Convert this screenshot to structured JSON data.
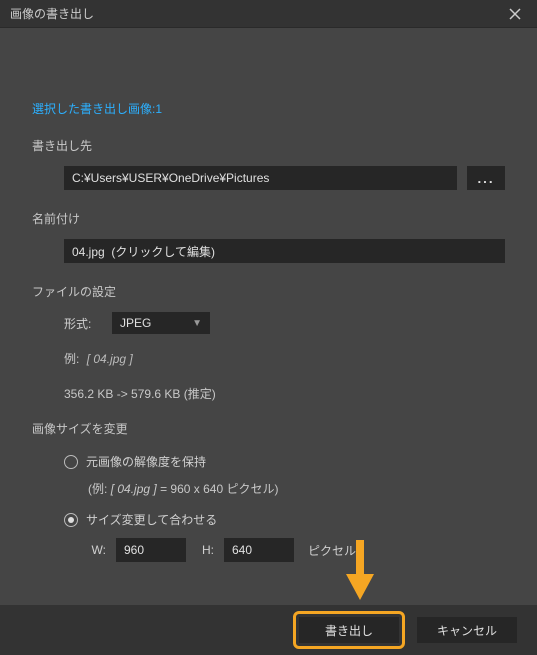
{
  "window": {
    "title": "画像の書き出し"
  },
  "header": {
    "selected_label": "選択した書き出し画像:",
    "selected_count": "1"
  },
  "destination": {
    "label": "書き出し先",
    "path": "C:¥Users¥USER¥OneDrive¥Pictures",
    "browse": "..."
  },
  "naming": {
    "label": "名前付け",
    "value": "04.jpg  (クリックして編集)"
  },
  "file_settings": {
    "label": "ファイルの設定",
    "format_label": "形式:",
    "format_value": "JPEG",
    "example_label": "例:",
    "example_value": "[ 04.jpg ]",
    "size_info": "356.2 KB -> 579.6 KB (推定)"
  },
  "resize": {
    "label": "画像サイズを変更",
    "keep_original_label": "元画像の解像度を保持",
    "keep_original_example_prefix": "(例:",
    "keep_original_example_value": "[ 04.jpg ]",
    "keep_original_example_suffix": "=  960 x 640 ピクセル)",
    "fit_label": "サイズ変更して合わせる",
    "width_label": "W:",
    "width_value": "960",
    "height_label": "H:",
    "height_value": "640",
    "unit": "ピクセル",
    "selected": "fit"
  },
  "footer": {
    "export": "書き出し",
    "cancel": "キャンセル"
  }
}
